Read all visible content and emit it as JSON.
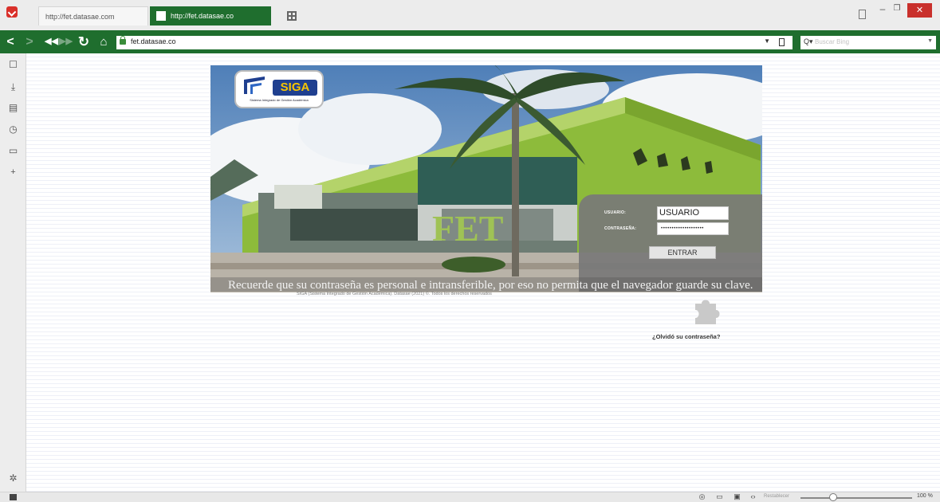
{
  "browser": {
    "tabs": [
      {
        "label": "http://fet.datasae.com"
      },
      {
        "label": "http://fet.datasae.co"
      }
    ],
    "url": "fet.datasae.co",
    "search_placeholder": "Buscar Bing",
    "zoom_label": "Restablecer",
    "zoom_value": "100 %"
  },
  "login": {
    "logo_text": "SIGA",
    "logo_tagline": "Sistema Integrado de Gestión Académica",
    "hero_letters": "FET",
    "user_label": "USUARIO:",
    "user_value": "USUARIO",
    "pass_label": "CONTRASEÑA:",
    "pass_value": "••••••••••••••••••••",
    "submit_label": "ENTRAR",
    "notice": "Recuerde que su contraseña es personal e intransferible, por eso no permita que el navegador guarde su clave.",
    "copyright": "SIGA (Sistema Integrado de Gestión Académica). Datasae (2021) ©. Todos los derechos reservados",
    "forgot_link": "¿Olvidó su contraseña?"
  },
  "colors": {
    "browser_accent": "#1f6e2e",
    "close_button": "#c9302c",
    "facade_green": "#8dbb3b"
  }
}
